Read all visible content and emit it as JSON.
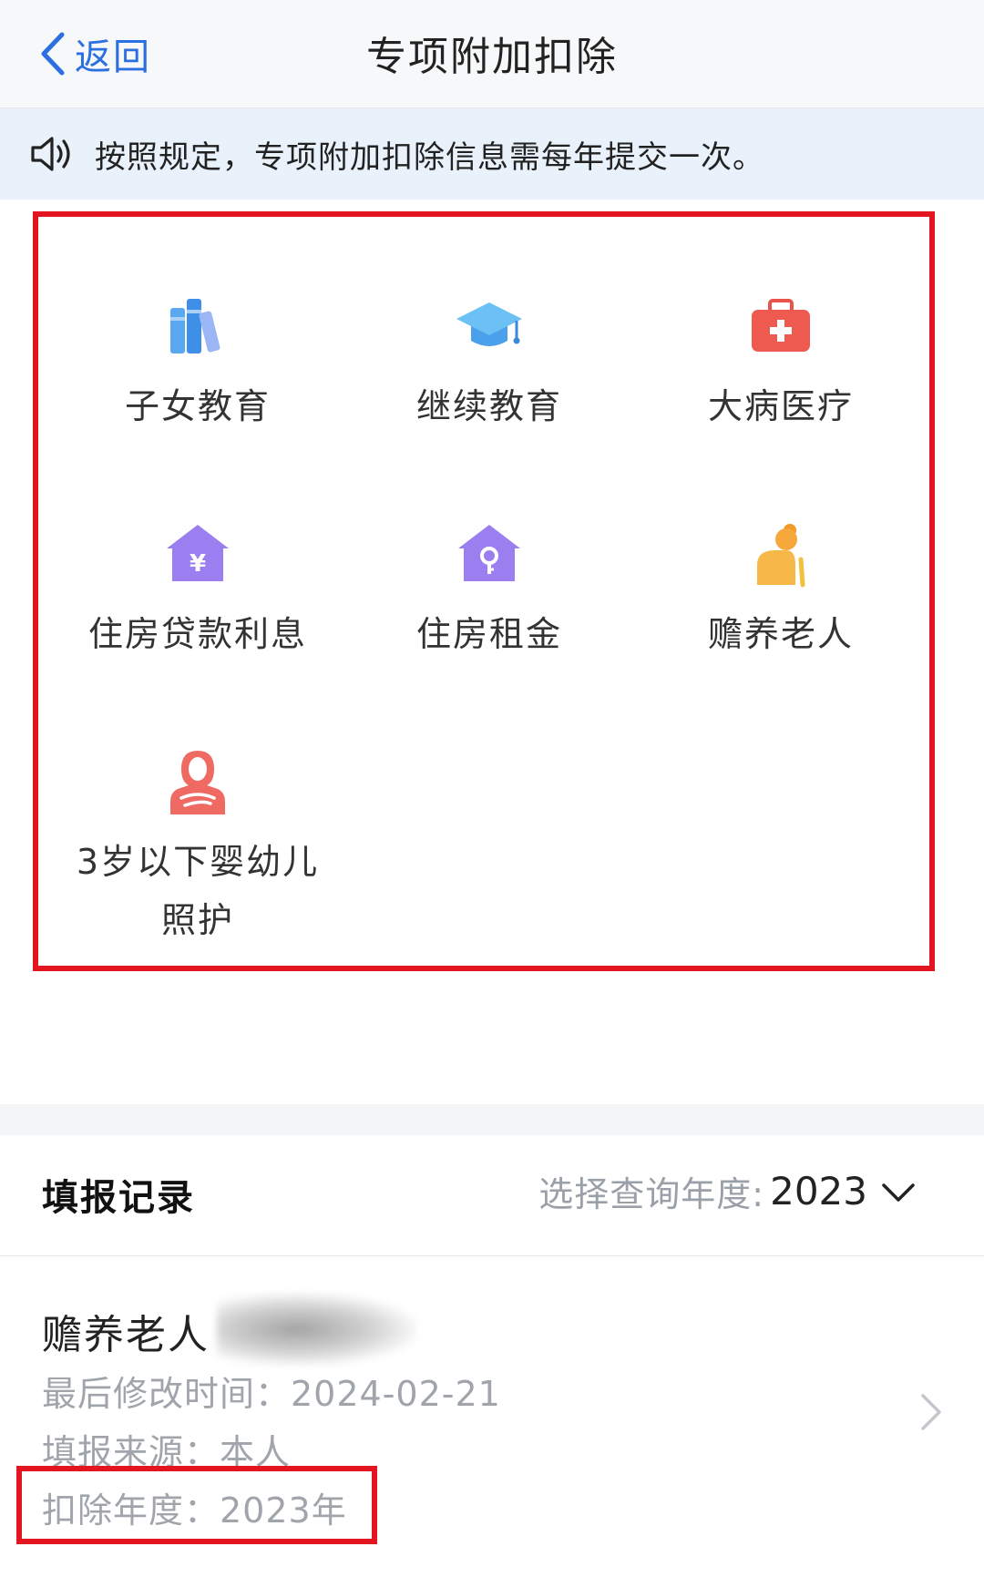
{
  "nav": {
    "back_label": "返回",
    "title": "专项附加扣除"
  },
  "notice": {
    "text": "按照规定，专项附加扣除信息需每年提交一次。"
  },
  "categories": [
    {
      "label": "子女教育",
      "icon": "books-icon"
    },
    {
      "label": "继续教育",
      "icon": "graduation-cap-icon"
    },
    {
      "label": "大病医疗",
      "icon": "medical-kit-icon"
    },
    {
      "label": "住房贷款利息",
      "icon": "house-yen-icon"
    },
    {
      "label": "住房租金",
      "icon": "house-key-icon"
    },
    {
      "label": "赡养老人",
      "icon": "elderly-person-icon"
    },
    {
      "label": "3岁以下婴幼儿照护",
      "icon": "mother-baby-icon"
    }
  ],
  "records": {
    "title": "填报记录",
    "year_picker_label": "选择查询年度:",
    "year_value": "2023",
    "items": [
      {
        "type": "赡养老人",
        "modified": "最后修改时间：2024-02-21",
        "source": "填报来源：本人",
        "year": "扣除年度：2023年"
      }
    ]
  },
  "colors": {
    "accent_blue": "#2c6fe0",
    "highlight_red": "#e3151f",
    "notice_bg": "#e9f1fb"
  }
}
